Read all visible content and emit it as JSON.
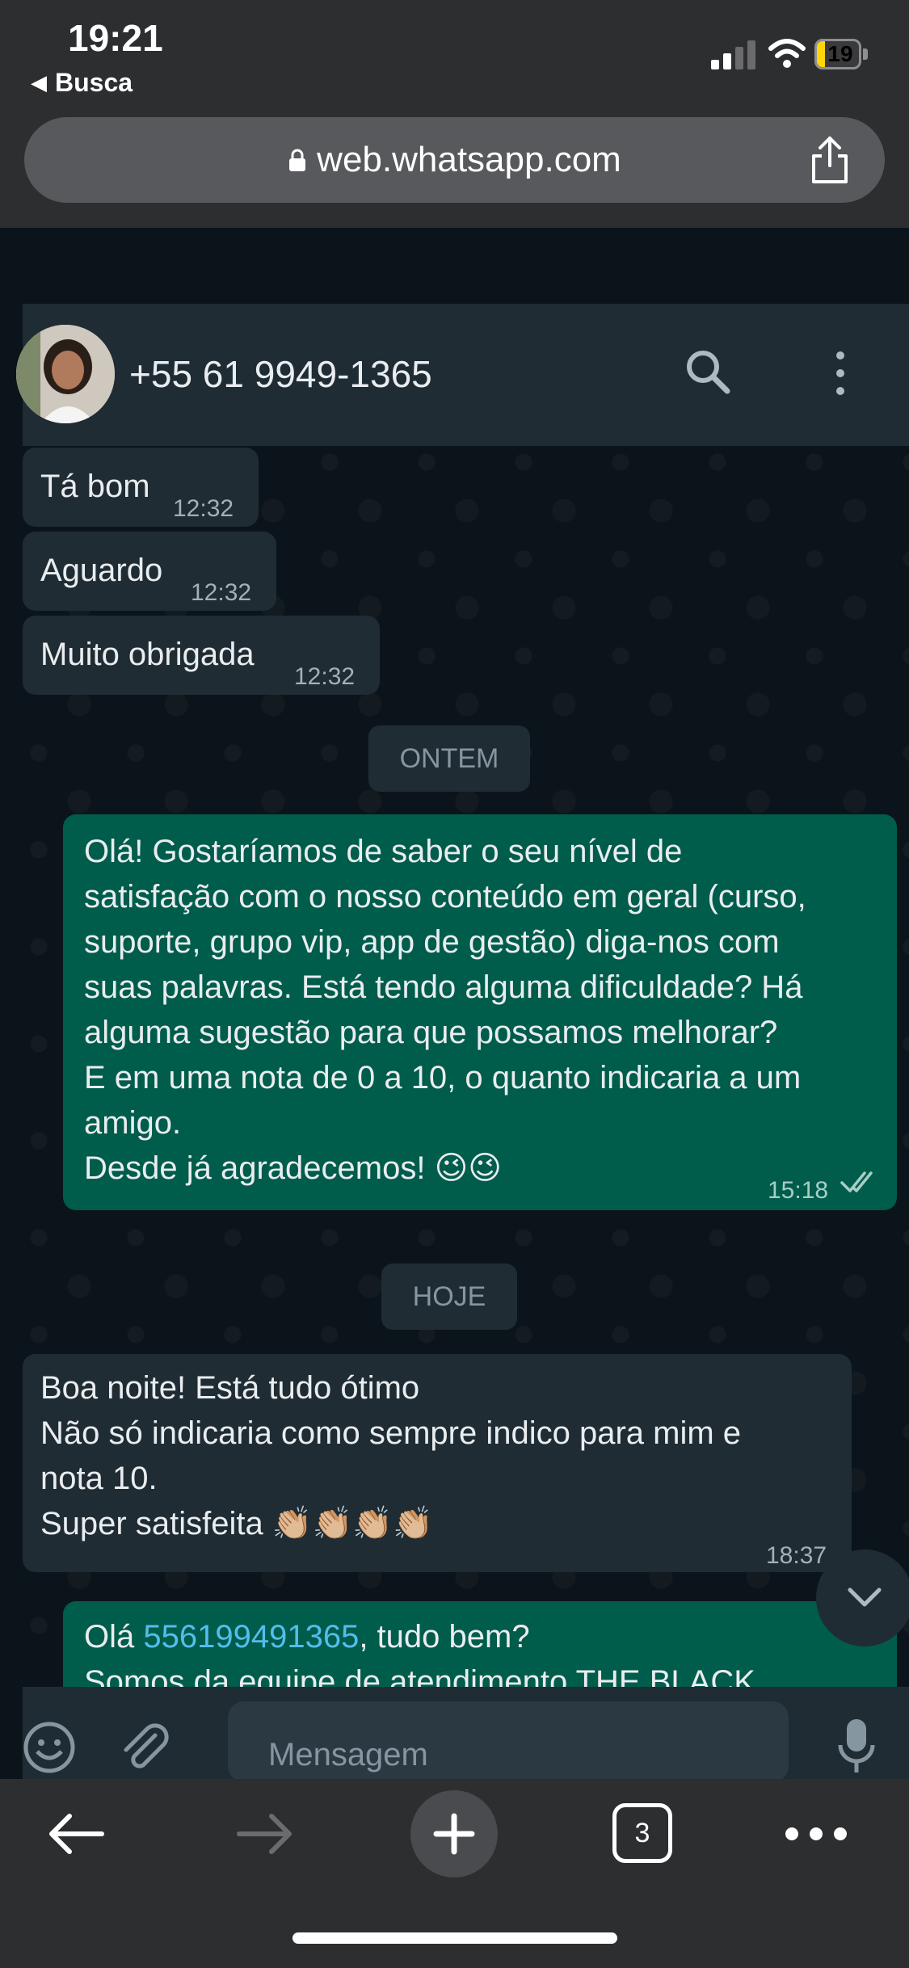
{
  "status_bar": {
    "time": "19:21",
    "back_app": "Busca",
    "battery_level": "19",
    "battery_fraction": 0.19,
    "battery_color": "#ffd60a"
  },
  "browser": {
    "url": "web.whatsapp.com",
    "open_tabs": "3",
    "icons": [
      "lock-icon",
      "share-icon",
      "back-arrow-icon",
      "forward-arrow-icon",
      "plus-icon",
      "tabs-icon",
      "more-icon"
    ]
  },
  "chat": {
    "contact": "+55 61 9949-1365",
    "messages": [
      {
        "direction": "in",
        "text": "Tá bom",
        "time": "12:32"
      },
      {
        "direction": "in",
        "text": "Aguardo",
        "time": "12:32"
      },
      {
        "direction": "in",
        "text": "Muito obrigada",
        "time": "12:32"
      },
      {
        "day": "ONTEM"
      },
      {
        "direction": "out",
        "text": "Olá! Gostaríamos de saber o seu nível de\nsatisfação com o nosso conteúdo em geral (curso,\nsuporte, grupo vip, app de gestão) diga-nos com\nsuas palavras. Está tendo alguma dificuldade? Há\nalguma sugestão para que possamos melhorar?\nE em uma nota de 0 a 10, o quanto indicaria a um\namigo.\nDesde já agradecemos! 😉😉",
        "time": "15:18",
        "status": "read"
      },
      {
        "day": "HOJE"
      },
      {
        "direction": "in",
        "text": "Boa noite! Está tudo ótimo\nNão só indicaria como sempre indico para mim e\nnota 10.\nSuper satisfeita 👏🏼👏🏼👏🏼👏🏼",
        "time": "18:37"
      },
      {
        "direction": "out",
        "text_before_link": "Olá ",
        "link": "556199491365",
        "text_after_link": ", tudo bem?",
        "partial_line": "Somos da equipe de atendimento THE BLACK"
      }
    ],
    "composer_placeholder": "Mensagem",
    "colors": {
      "incoming": "#202c33",
      "outgoing": "#005c4b",
      "background": "#0b141a",
      "header": "#1f2c34",
      "link": "#53bdeb"
    }
  }
}
